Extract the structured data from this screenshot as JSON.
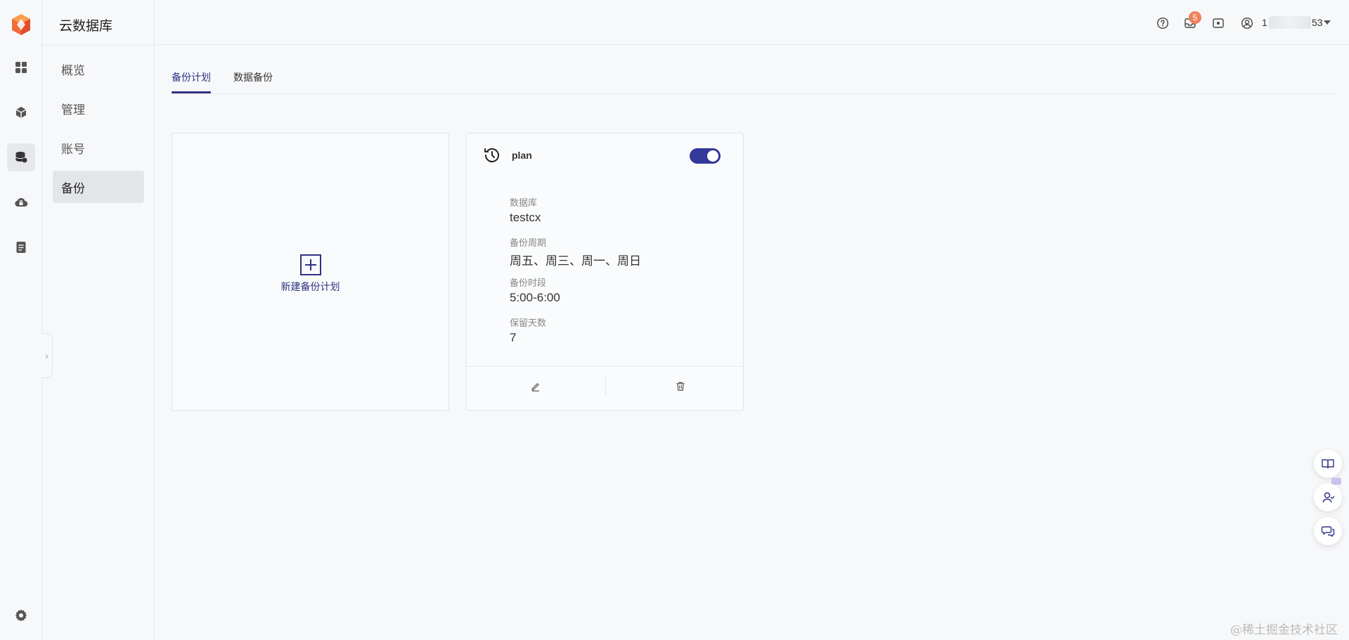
{
  "app": {
    "title": "云数据库"
  },
  "rail": {
    "items": [
      {
        "icon": "dashboard-icon"
      },
      {
        "icon": "cube-icon"
      },
      {
        "icon": "database-icon",
        "active": true
      },
      {
        "icon": "cloud-lock-icon"
      },
      {
        "icon": "document-icon"
      }
    ],
    "settings_icon": "gear-icon"
  },
  "subnav": {
    "items": [
      {
        "label": "概览"
      },
      {
        "label": "管理"
      },
      {
        "label": "账号"
      },
      {
        "label": "备份",
        "active": true
      }
    ],
    "collapse_glyph": "›"
  },
  "header": {
    "notification_count": "5",
    "user": {
      "name_start": "1",
      "name_end": "53"
    }
  },
  "tabs": [
    {
      "label": "备份计划",
      "active": true
    },
    {
      "label": "数据备份"
    }
  ],
  "new_plan": {
    "label": "新建备份计划"
  },
  "plan": {
    "name": "plan",
    "enabled": true,
    "fields": [
      {
        "label": "数据库",
        "value": "testcx"
      },
      {
        "label": "备份周期",
        "value": "周五、周三、周一、周日"
      },
      {
        "label": "备份时段",
        "value": "5:00-6:00"
      },
      {
        "label": "保留天数",
        "value": "7"
      }
    ]
  },
  "watermark": "@稀土掘金技术社区",
  "colors": {
    "accent": "#2f3383",
    "toggle": "#34389a",
    "badge": "#f0805a",
    "background": "#f7f8fa"
  }
}
